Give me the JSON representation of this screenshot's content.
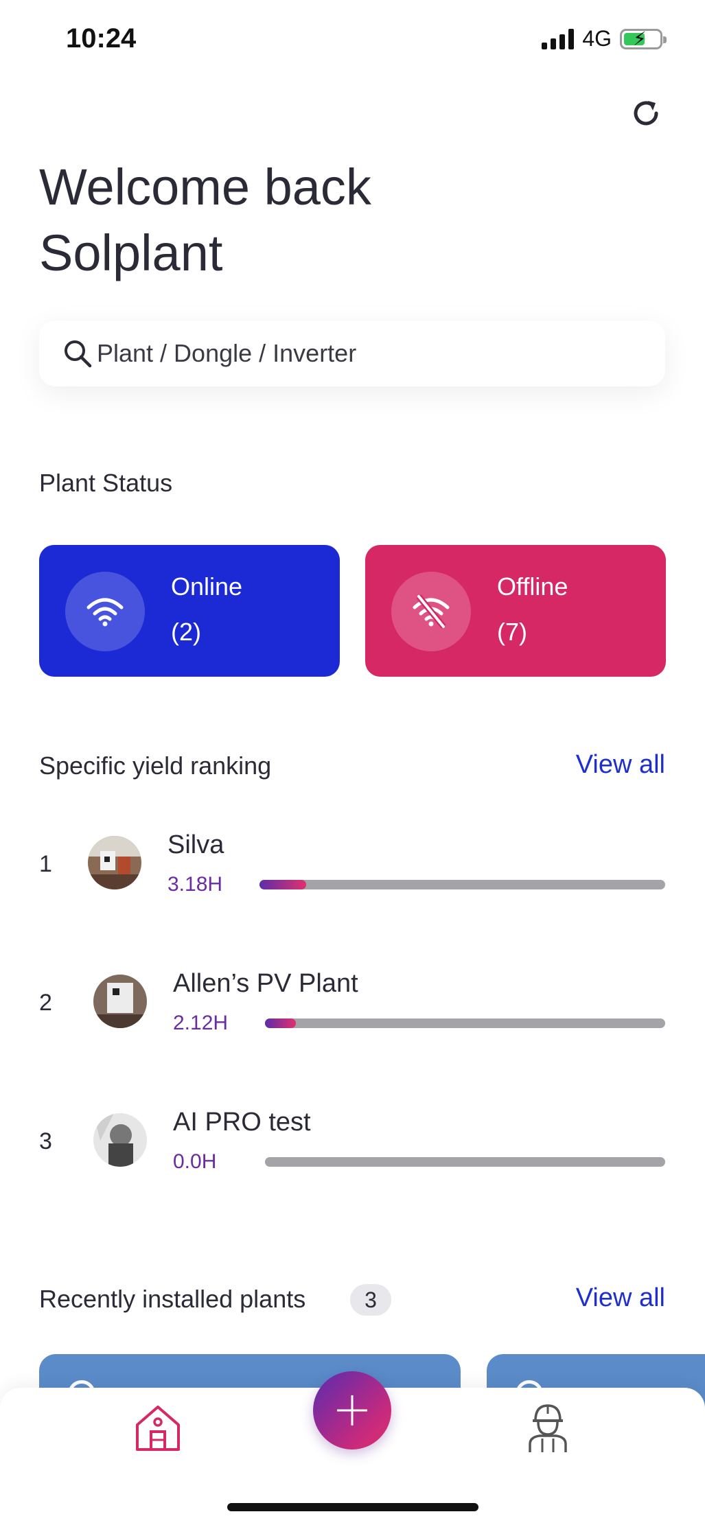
{
  "status_bar": {
    "time": "10:24",
    "network": "4G",
    "battery_level": 0.6
  },
  "header": {
    "welcome_line1": "Welcome back",
    "welcome_line2": "Solplant"
  },
  "search": {
    "placeholder": "Plant / Dongle / Inverter"
  },
  "plant_status": {
    "title": "Plant Status",
    "online": {
      "label": "Online",
      "count": "(2)",
      "color": "#1c2ad6",
      "icon": "wifi-icon"
    },
    "offline": {
      "label": "Offline",
      "count": "(7)",
      "color": "#d72866",
      "icon": "wifi-off-icon"
    }
  },
  "ranking": {
    "title": "Specific yield ranking",
    "view_all": "View all",
    "items": [
      {
        "rank": "1",
        "name": "Silva",
        "value": "3.18H",
        "fraction": 0.115
      },
      {
        "rank": "2",
        "name": "Allen’s PV Plant",
        "value": "2.12H",
        "fraction": 0.077
      },
      {
        "rank": "3",
        "name": "AI PRO test",
        "value": "0.0H",
        "fraction": 0.0
      }
    ]
  },
  "recent": {
    "title": "Recently installed plants",
    "count": "3",
    "view_all": "View all"
  },
  "tabbar": {
    "home_icon": "home-icon",
    "add_icon": "plus-icon",
    "profile_icon": "engineer-icon"
  }
}
